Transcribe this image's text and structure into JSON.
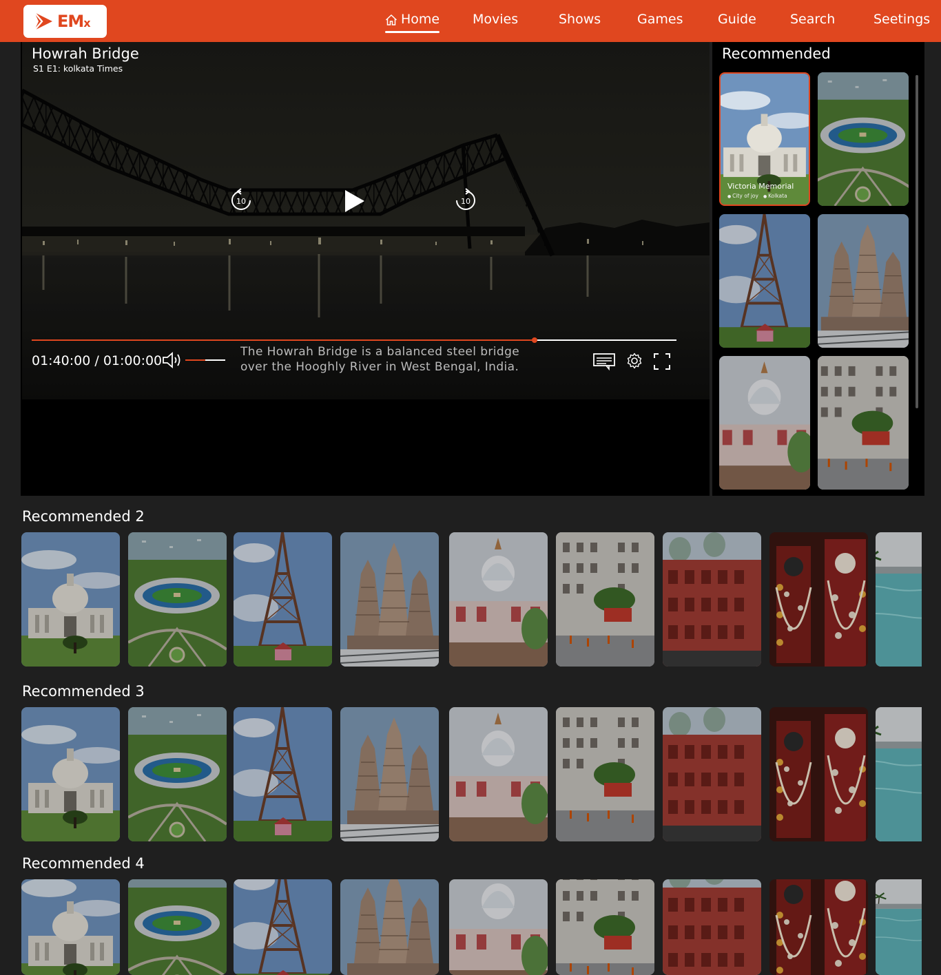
{
  "brand": {
    "logo_text": "EM",
    "logo_suffix": "x",
    "color": "#e0471f"
  },
  "nav": [
    {
      "label": "Home",
      "icon": "home-icon",
      "active": true
    },
    {
      "label": "Movies",
      "icon": "grid-icon"
    },
    {
      "label": "Shows",
      "icon": "grid-icon"
    },
    {
      "label": "Games",
      "icon": "grid-icon"
    },
    {
      "label": "Guide",
      "icon": "grid-icon"
    },
    {
      "label": "Search",
      "icon": "grid-icon"
    },
    {
      "label": "Seetings",
      "icon": "grid-icon"
    }
  ],
  "player": {
    "title": "Howrah Bridge",
    "subtitle": "S1 E1: kolkata Times",
    "time": "01:40:00 / 01:00:00",
    "progress_fraction": 0.78,
    "volume_fraction": 0.5,
    "caption": "The Howrah Bridge is a balanced steel bridge over the Hooghly River in West Bengal, India.",
    "skip_back_label": "10",
    "skip_forward_label": "10"
  },
  "sidebar": {
    "title": "Recommended",
    "items": [
      {
        "scene": "memorial",
        "title": "Victoria Memorial",
        "tags": [
          "City of joy",
          "Kolkata"
        ],
        "selected": true
      },
      {
        "scene": "stadium"
      },
      {
        "scene": "tower"
      },
      {
        "scene": "temple"
      },
      {
        "scene": "kalighat"
      },
      {
        "scene": "street"
      }
    ]
  },
  "rows": [
    {
      "title": "Recommended 2",
      "items": [
        "memorial",
        "stadium",
        "tower",
        "temple",
        "kalighat",
        "street",
        "redbuilding",
        "deity",
        "pool"
      ]
    },
    {
      "title": "Recommended 3",
      "items": [
        "memorial",
        "stadium",
        "tower",
        "temple",
        "kalighat",
        "street",
        "redbuilding",
        "deity",
        "pool"
      ]
    },
    {
      "title": "Recommended 4",
      "items": [
        "memorial",
        "stadium",
        "tower",
        "temple",
        "kalighat",
        "street",
        "redbuilding",
        "deity",
        "pool"
      ]
    }
  ],
  "colors": {
    "accent": "#e0471f",
    "background": "#1f1f1f",
    "panel": "#000000"
  }
}
